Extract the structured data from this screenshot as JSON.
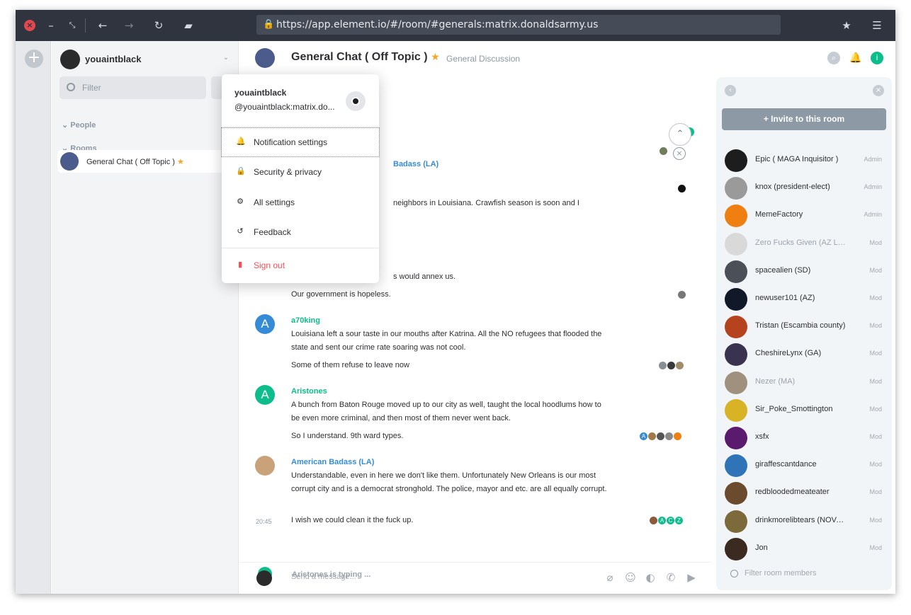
{
  "browser": {
    "url": "https://app.element.io/#/room/#generals:matrix.donaldsarmy.us"
  },
  "sidebar": {
    "user_name": "youaintblack",
    "filter_placeholder": "Filter",
    "sections": [
      "People",
      "Rooms"
    ],
    "rooms": [
      {
        "label": "General Chat ( Off Topic )",
        "favourite": "★"
      }
    ]
  },
  "room": {
    "title": "General Chat ( Off Topic )",
    "star": "★",
    "topic": "General Discussion"
  },
  "timeline": {
    "partial_sender": "Badass (LA)",
    "partial_text_1": "neighbors in Louisiana. Crawfish season is soon and I",
    "partial_text_2": "s would annex us.",
    "partial_text_3": "Our government is hopeless.",
    "messages": [
      {
        "sender": "a70king",
        "avatar_letter": "A",
        "color": "#368bd6",
        "lines": [
          "Louisiana left a sour taste in our mouths after Katrina. All the NO refugees that flooded the state and sent our crime rate soaring was not cool.",
          "Some of them refuse to leave now"
        ]
      },
      {
        "sender": "Aristones",
        "avatar_letter": "A",
        "color": "#0dbd8b",
        "lines": [
          "A bunch from Baton Rouge moved up to our city as well, taught the local hoodlums how to be even more criminal, and then most of them never went back.",
          "So I understand.  9th ward types."
        ]
      },
      {
        "sender": "American Badass (LA)",
        "avatar_letter": "",
        "color": "#368bd6",
        "lines": [
          "Understandable, even in here we don't like them. Unfortunately New Orleans is our most corrupt city and is a democrat stronghold. The police, mayor and etc. are all equally corrupt.",
          "I wish we could clean it the fuck up."
        ],
        "timestamp": "20:45"
      }
    ],
    "receipt_letters": [
      "A",
      "C",
      "Z"
    ],
    "typing_avatar": "A",
    "typing": "Aristones is typing ..."
  },
  "composer": {
    "placeholder": "Send a message..."
  },
  "members_panel": {
    "invite_label": "Invite to this room",
    "filter_placeholder": "Filter room members",
    "members": [
      {
        "name": "Epic ( MAGA Inquisitor )",
        "role": "Admin",
        "dim": false,
        "color": "#1d1d1d"
      },
      {
        "name": "knox (president-elect)",
        "role": "Admin",
        "dim": false,
        "color": "#9a9a9a"
      },
      {
        "name": "MemeFactory",
        "role": "Admin",
        "dim": false,
        "color": "#f07f12"
      },
      {
        "name": "Zero Fucks Given (AZ Lead)",
        "role": "Mod",
        "dim": true,
        "color": "#d9d9d9"
      },
      {
        "name": "spacealien (SD)",
        "role": "Mod",
        "dim": false,
        "color": "#4b5058"
      },
      {
        "name": "newuser101 (AZ)",
        "role": "Mod",
        "dim": false,
        "color": "#111827"
      },
      {
        "name": "Tristan (Escambia county)",
        "role": "Mod",
        "dim": false,
        "color": "#b5431d"
      },
      {
        "name": "CheshireLynx (GA)",
        "role": "Mod",
        "dim": false,
        "color": "#3a3350"
      },
      {
        "name": "Nezer (MA)",
        "role": "Mod",
        "dim": true,
        "color": "#a0917f"
      },
      {
        "name": "Sir_Poke_Smottington",
        "role": "Mod",
        "dim": false,
        "color": "#d8b325"
      },
      {
        "name": "xsfx",
        "role": "Mod",
        "dim": false,
        "color": "#5a1a6e"
      },
      {
        "name": "giraffescantdance",
        "role": "Mod",
        "dim": false,
        "color": "#2e74b7"
      },
      {
        "name": "redbloodedmeateater",
        "role": "Mod",
        "dim": false,
        "color": "#6b4b2d"
      },
      {
        "name": "drinkmorelibtears (NOVA Le...",
        "role": "Mod",
        "dim": false,
        "color": "#7d6a3b"
      },
      {
        "name": "Jon",
        "role": "Mod",
        "dim": false,
        "color": "#3b2a20"
      }
    ]
  },
  "user_menu": {
    "display_name": "youaintblack",
    "user_id": "@youaintblack:matrix.do...",
    "items": [
      {
        "label": "Notification settings",
        "icon": "🔔"
      },
      {
        "label": "Security & privacy",
        "icon": "🔒"
      },
      {
        "label": "All settings",
        "icon": "⚙"
      },
      {
        "label": "Feedback",
        "icon": "↺"
      }
    ],
    "sign_out": "Sign out"
  }
}
